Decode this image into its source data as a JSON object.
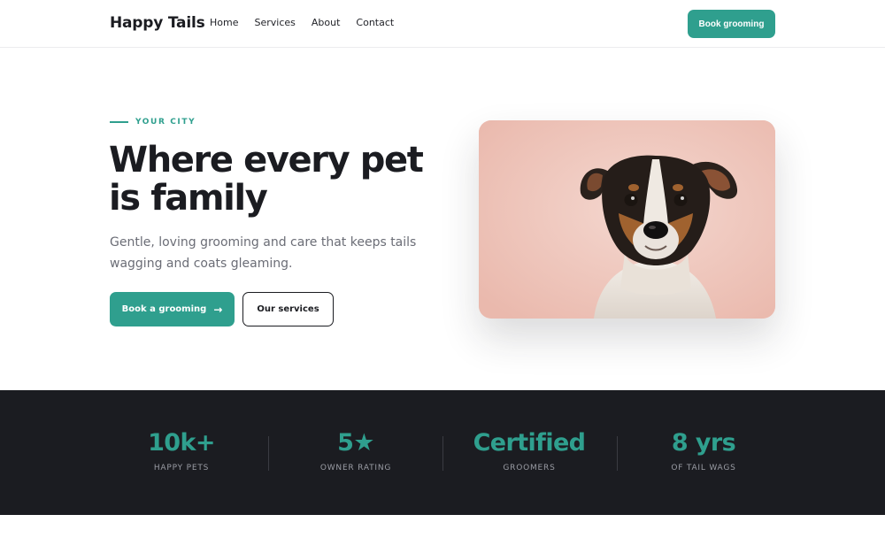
{
  "header": {
    "brand": "Happy Tails",
    "nav": [
      "Home",
      "Services",
      "About",
      "Contact"
    ],
    "cta_label": "Book grooming"
  },
  "hero": {
    "eyebrow": "YOUR CITY",
    "title": "Where every pet is family",
    "subtitle": "Gentle, loving grooming and care that keeps tails wagging and coats gleaming.",
    "primary_label": "Book a grooming",
    "primary_icon": "→",
    "secondary_label": "Our services",
    "image_alt": "dog-portrait"
  },
  "stats": [
    {
      "value": "10k+",
      "label": "HAPPY PETS"
    },
    {
      "value": "5★",
      "label": "OWNER RATING"
    },
    {
      "value": "Certified",
      "label": "GROOMERS"
    },
    {
      "value": "8 yrs",
      "label": "OF TAIL WAGS"
    }
  ],
  "colors": {
    "accent": "#2f9f8e",
    "dark": "#1b1c21",
    "muted": "#6b6d76",
    "image_background": "#eec4b8"
  }
}
